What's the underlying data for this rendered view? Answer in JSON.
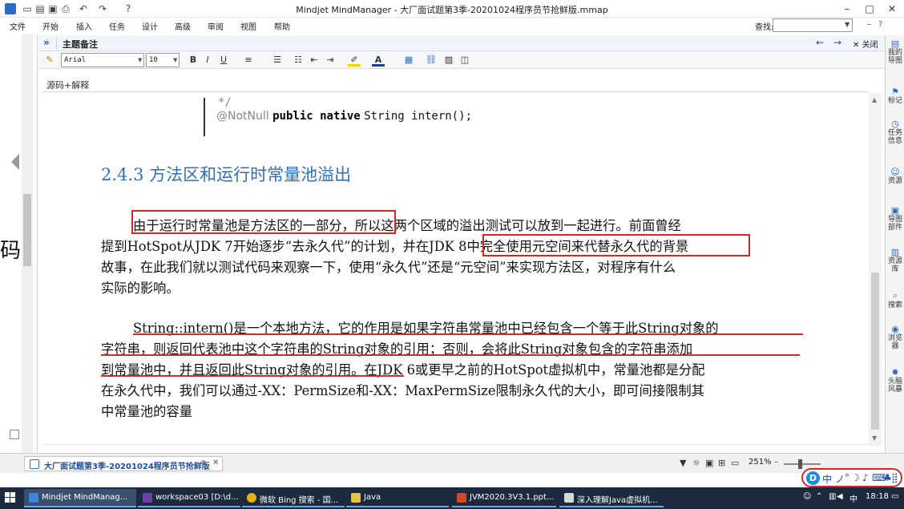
{
  "window": {
    "title": "Mindjet MindManager - 大厂面试题第3季-20201024程序员节抢鲜版.mmap",
    "minimize": "–",
    "maximize": "□",
    "close": "✕"
  },
  "menu": {
    "items": [
      "文件",
      "开始",
      "插入",
      "任务",
      "设计",
      "高级",
      "审阅",
      "视图",
      "帮助"
    ],
    "find_label": "查找:",
    "find_value": "",
    "help_icon": "?",
    "minimize_ribbon": "–"
  },
  "notes_panel": {
    "title": "主题备注",
    "close_label": "关闭",
    "font_name": "Arial",
    "font_size": "10",
    "bold": "B",
    "italic": "I",
    "underline": "U",
    "subject": "源码+解释"
  },
  "document": {
    "code_line1": "*/",
    "code_annotation": "@NotNull",
    "code_keywords": "public native",
    "code_rest": "String intern();",
    "heading": "2.4.3   方法区和运行时常量池溢出",
    "paragraph1": [
      "由于运行时常量池是方法区的一部分，所以这两个区域的溢出测试可以放到一起进行。前面曾经",
      "提到HotSpot从JDK 7开始逐步“去永久代”的计划，并在JDK 8中完全使用元空间来代替永久代的背景",
      "故事，在此我们就以测试代码来观察一下，使用“永久代”还是“元空间”来实现方法区，对程序有什么",
      "实际的影响。"
    ],
    "paragraph2": [
      "String::intern()是一个本地方法，它的作用是如果字符串常量池中已经包含一个等于此String对象的",
      "字符串，则返回代表池中这个字符串的String对象的引用；否则，会将此String对象包含的字符串添加",
      "到常量池中，并且返回此String对象的引用。在JDK 6或更早之前的HotSpot虚拟机中，常量池都是分配",
      "在永久代中，我们可以通过-XX：PermSize和-XX：MaxPermSize限制永久代的大小，即可间接限制其",
      "中常量池的容量"
    ]
  },
  "sidepanel": {
    "items": [
      "我的导图",
      "标记",
      "任务信息",
      "资源",
      "导图部件",
      "资源库",
      "搜索",
      "浏览器",
      "头脑风暴"
    ]
  },
  "doc_tab": {
    "label": "大厂面试题第3季-20201024程序员节抢鲜版"
  },
  "status": {
    "zoom": "251%"
  },
  "ime": {
    "logo": "D",
    "lang": "中",
    "punct": "ノ",
    "dot": "°",
    "moon": "☽",
    "mic": "♪",
    "keyboard": "⌨",
    "shirt": "♣",
    "grid": "⣿"
  },
  "taskbar": {
    "items": [
      "Mindjet MindManag...",
      "workspace03 [D:\\d...",
      "微软 Bing 搜索 - 国...",
      "Java",
      "JVM2020.3V3.1.ppt...",
      "深入理解Java虚拟机..."
    ],
    "time": "18:18"
  },
  "colors": {
    "accent": "#2b6cc8",
    "heading": "#2f6fb8",
    "annotation": "#d12828",
    "taskbar": "#1c2a3e"
  }
}
